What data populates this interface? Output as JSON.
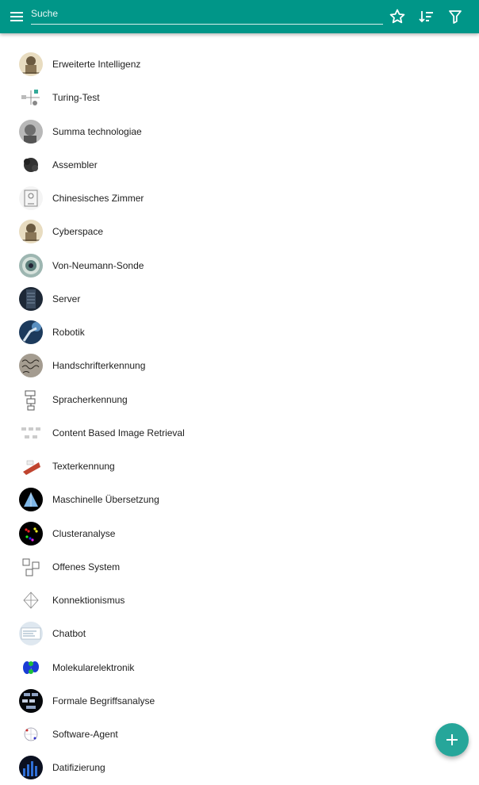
{
  "search": {
    "placeholder": "Suche"
  },
  "toolbar": {
    "menu_icon": "menu-icon",
    "favorite_icon": "star-outline-icon",
    "sort_icon": "sort-icon",
    "filter_icon": "filter-icon",
    "accent": "#009688"
  },
  "list": {
    "items": [
      {
        "label": "Erweiterte Intelligenz",
        "thumb": "engraving"
      },
      {
        "label": "Turing-Test",
        "thumb": "diagram"
      },
      {
        "label": "Summa technologiae",
        "thumb": "portrait"
      },
      {
        "label": "Assembler",
        "thumb": "chip"
      },
      {
        "label": "Chinesisches Zimmer",
        "thumb": "sketch"
      },
      {
        "label": "Cyberspace",
        "thumb": "engraving"
      },
      {
        "label": "Von-Neumann-Sonde",
        "thumb": "probe"
      },
      {
        "label": "Server",
        "thumb": "rack"
      },
      {
        "label": "Robotik",
        "thumb": "robot-arm"
      },
      {
        "label": "Handschrifterkennung",
        "thumb": "handwriting"
      },
      {
        "label": "Spracherkennung",
        "thumb": "flowchart"
      },
      {
        "label": "Content Based Image Retrieval",
        "thumb": "block-diagram"
      },
      {
        "label": "Texterkennung",
        "thumb": "scanner"
      },
      {
        "label": "Maschinelle Übersetzung",
        "thumb": "pyramid"
      },
      {
        "label": "Clusteranalyse",
        "thumb": "clusters"
      },
      {
        "label": "Offenes System",
        "thumb": "boxes"
      },
      {
        "label": "Konnektionismus",
        "thumb": "network"
      },
      {
        "label": "Chatbot",
        "thumb": "screenshot"
      },
      {
        "label": "Molekularelektronik",
        "thumb": "molecule"
      },
      {
        "label": "Formale Begriffsanalyse",
        "thumb": "lattice"
      },
      {
        "label": "Software-Agent",
        "thumb": "agent-diagram"
      },
      {
        "label": "Datifizierung",
        "thumb": "dark-chart"
      }
    ]
  },
  "fab": {
    "icon": "plus-icon",
    "color": "#26a69a"
  }
}
